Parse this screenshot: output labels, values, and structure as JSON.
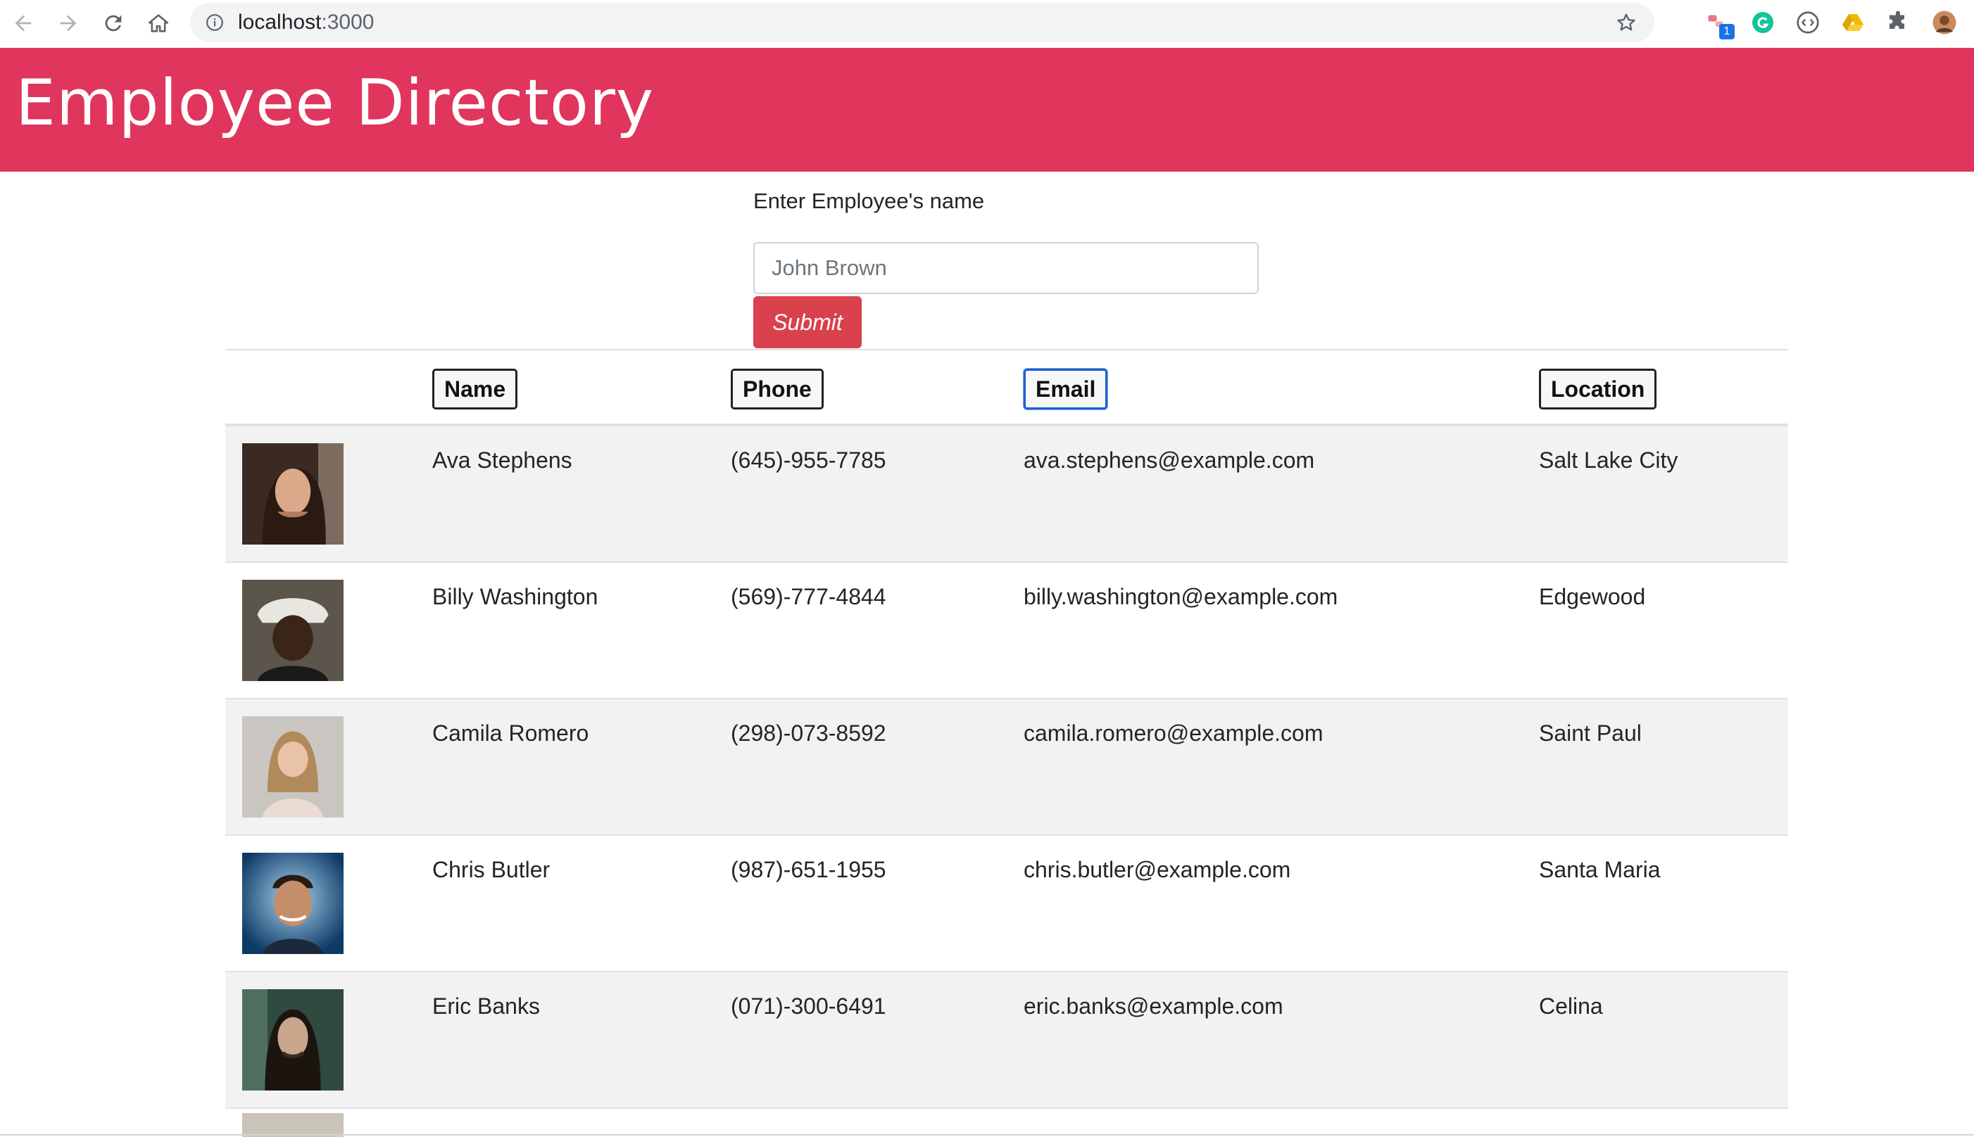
{
  "browser": {
    "url_host": "localhost",
    "url_port": ":3000",
    "extension_badge": "1"
  },
  "app": {
    "title": "Employee Directory"
  },
  "search": {
    "label": "Enter Employee's name",
    "placeholder": "John Brown",
    "value": "",
    "submit_label": "Submit"
  },
  "table": {
    "headers": {
      "name": "Name",
      "phone": "Phone",
      "email": "Email",
      "location": "Location"
    },
    "rows": [
      {
        "name": "Ava Stephens",
        "phone": "(645)-955-7785",
        "email": "ava.stephens@example.com",
        "location": "Salt Lake City"
      },
      {
        "name": "Billy Washington",
        "phone": "(569)-777-4844",
        "email": "billy.washington@example.com",
        "location": "Edgewood"
      },
      {
        "name": "Camila Romero",
        "phone": "(298)-073-8592",
        "email": "camila.romero@example.com",
        "location": "Saint Paul"
      },
      {
        "name": "Chris Butler",
        "phone": "(987)-651-1955",
        "email": "chris.butler@example.com",
        "location": "Santa Maria"
      },
      {
        "name": "Eric Banks",
        "phone": "(071)-300-6491",
        "email": "eric.banks@example.com",
        "location": "Celina"
      }
    ]
  },
  "colors": {
    "header_bg": "#e0355c",
    "submit_bg": "#d9414d",
    "row_stripe": "#f2f2f2",
    "focus_ring": "#1c5fd1"
  }
}
